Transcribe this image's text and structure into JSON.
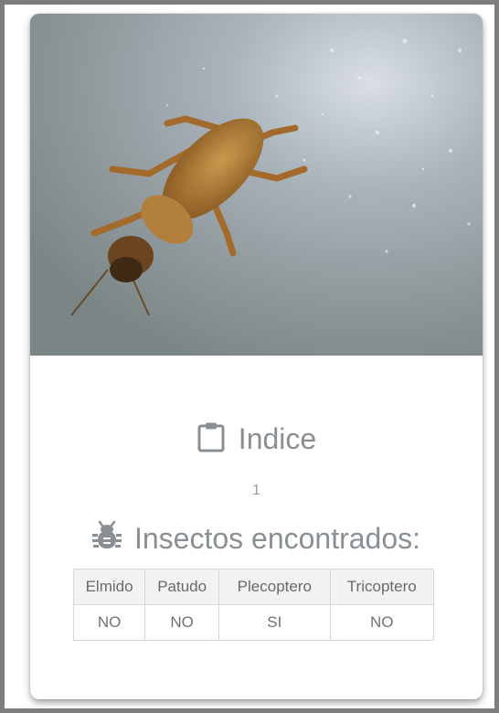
{
  "index": {
    "icon": "clipboard-icon",
    "title": "Indice",
    "value": "1"
  },
  "insects": {
    "icon": "bug-icon",
    "title": "Insectos encontrados:",
    "columns": [
      "Elmido",
      "Patudo",
      "Plecoptero",
      "Tricoptero"
    ],
    "values": [
      "NO",
      "NO",
      "SI",
      "NO"
    ]
  },
  "colors": {
    "frame": "#7d7d7d",
    "text": "#8a8f93",
    "header_bg": "#f2f2f2"
  }
}
